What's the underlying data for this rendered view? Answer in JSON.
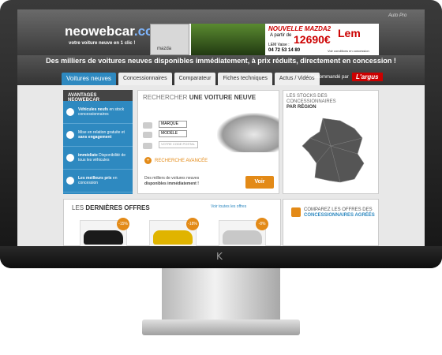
{
  "site": {
    "brand": "neowebcar",
    "brand_suffix": ".com",
    "tagline": "votre voiture neuve en 1 clic !",
    "headline": "Des milliers de voitures neuves disponibles immédiatement, à prix réduits, directement en concession !",
    "auto_pro": "Auto Pro"
  },
  "banner": {
    "brand": "mazda",
    "title": "NOUVELLE MAZDA2",
    "prefix": "A partir de",
    "price": "12690€",
    "dealer_line": "LEM Vaise :",
    "phone": "04 72 53 14 80",
    "dealer_logo": "Lem",
    "note": "Voir conditions en concession"
  },
  "tabs": [
    {
      "label": "Voitures neuves",
      "active": true
    },
    {
      "label": "Concessionnaires",
      "active": false
    },
    {
      "label": "Comparateur",
      "active": false
    },
    {
      "label": "Fiches techniques",
      "active": false
    },
    {
      "label": "Actus / Vidéos",
      "active": false
    }
  ],
  "recommended": {
    "label": "Recommandé par",
    "partner": "L'argus"
  },
  "advantages": {
    "title": "AVANTAGES NEOWEBCAR",
    "items": [
      {
        "bold": "Véhicules neufs",
        "text": "en stock concessionnaires"
      },
      {
        "bold": "sans engagement",
        "text": "Mise en relation gratuite et"
      },
      {
        "bold": "immédiate",
        "text": "Disponibilité de tous les véhicules"
      },
      {
        "bold": "Les meilleurs prix",
        "text": "en concession"
      }
    ]
  },
  "search": {
    "title_light": "RECHERCHER",
    "title_bold": "UNE VOITURE NEUVE",
    "brand_select": "MARQUE",
    "model_select": "MODÈLE",
    "postal_placeholder": "VOTRE CODE POSTAL",
    "advanced": "RECHERCHE AVANCÉE",
    "footer_1": "Des milliers de voitures neuves",
    "footer_2": "disponibles immédiatement !",
    "submit": "Voir"
  },
  "stocks": {
    "title": "LES STOCKS DES CONCESSIONNAIRES",
    "subtitle": "PAR RÉGION"
  },
  "offers": {
    "title_light": "LES",
    "title_bold": "DERNIÈRES OFFRES",
    "see_all": "Voir toutes les offres",
    "items": [
      {
        "discount": "-15%",
        "color": "#1a1a1a"
      },
      {
        "discount": "-18%",
        "color": "#e0b400"
      },
      {
        "discount": "-8%",
        "color": "#c8c8c8"
      }
    ]
  },
  "dealers": {
    "title": "COMPAREZ LES OFFRES DES",
    "bold": "CONCESSIONNAIRES AGRÉÉS"
  },
  "colors": {
    "accent": "#2e89c0",
    "orange": "#e38a17"
  }
}
